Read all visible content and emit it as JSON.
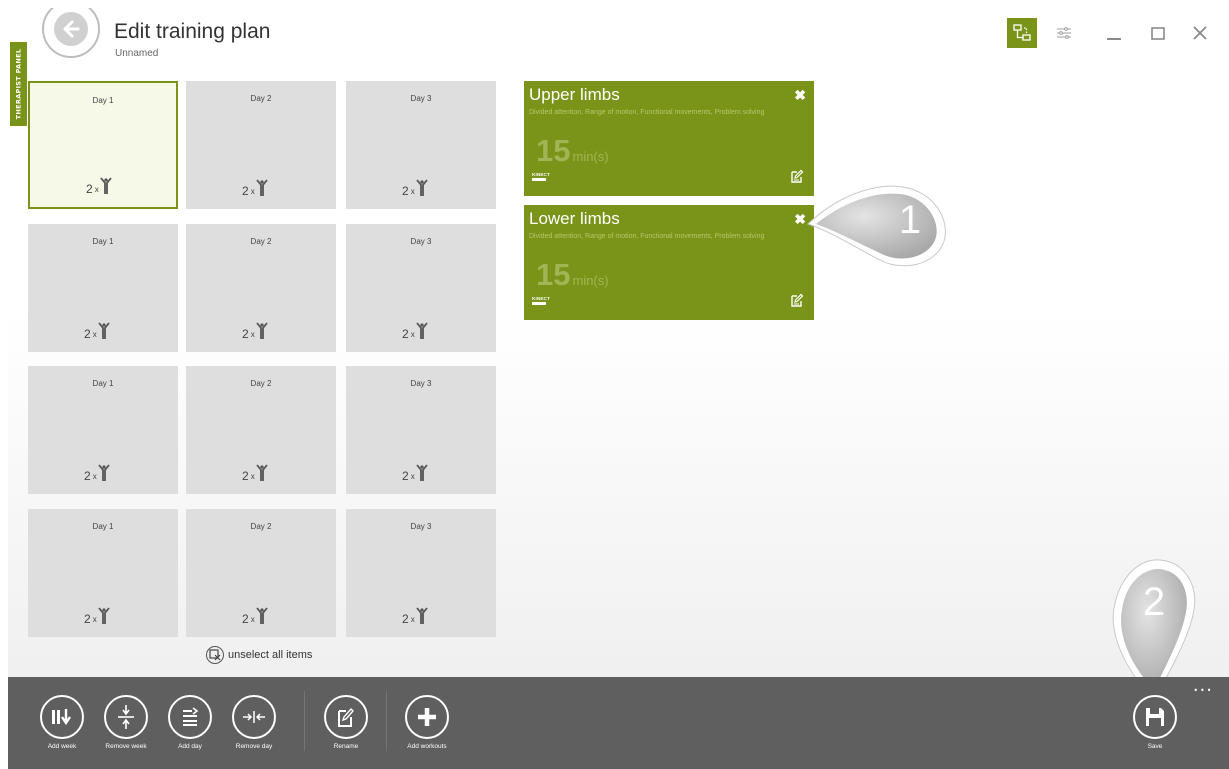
{
  "header": {
    "title": "Edit training plan",
    "subtitle": "Unnamed",
    "therapist_panel": "THERAPIST PANEL"
  },
  "days": [
    {
      "label": "Day 1",
      "count": "2",
      "times": "x"
    },
    {
      "label": "Day 2",
      "count": "2",
      "times": "x"
    },
    {
      "label": "Day 3",
      "count": "2",
      "times": "x"
    },
    {
      "label": "Day 1",
      "count": "2",
      "times": "x"
    },
    {
      "label": "Day 2",
      "count": "2",
      "times": "x"
    },
    {
      "label": "Day 3",
      "count": "2",
      "times": "x"
    },
    {
      "label": "Day 1",
      "count": "2",
      "times": "x"
    },
    {
      "label": "Day 2",
      "count": "2",
      "times": "x"
    },
    {
      "label": "Day 3",
      "count": "2",
      "times": "x"
    },
    {
      "label": "Day 1",
      "count": "2",
      "times": "x"
    },
    {
      "label": "Day 2",
      "count": "2",
      "times": "x"
    },
    {
      "label": "Day 3",
      "count": "2",
      "times": "x"
    }
  ],
  "unselect_label": "unselect all items",
  "workouts": [
    {
      "name": "Upper limbs",
      "description": "Divided attention, Range of motion, Functional movements, Problem solving",
      "duration": "15",
      "unit": "min(s)",
      "device": "KINECT"
    },
    {
      "name": "Lower limbs",
      "description": "Divided attention, Range of motion, Functional movements, Problem solving",
      "duration": "15",
      "unit": "min(s)",
      "device": "KINECT"
    }
  ],
  "callouts": [
    "1",
    "2"
  ],
  "appbar": {
    "add_week": "Add week",
    "remove_week": "Remove week",
    "add_day": "Add day",
    "remove_day": "Remove day",
    "rename": "Rename",
    "add_workouts": "Add workouts",
    "save": "Save",
    "more": "..."
  },
  "colors": {
    "accent": "#7a941a",
    "appbar": "#5f5f5f",
    "day_tile": "#dedede"
  }
}
